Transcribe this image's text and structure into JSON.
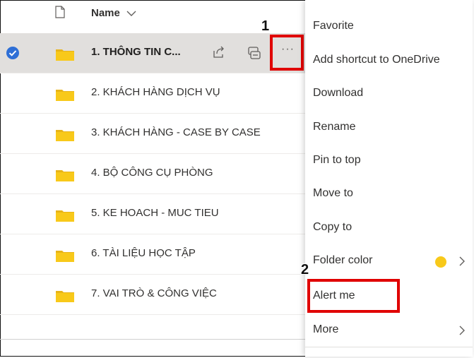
{
  "list": {
    "header": {
      "name_label": "Name"
    },
    "rows": [
      {
        "label": "1. THÔNG TIN C...",
        "selected": true
      },
      {
        "label": "2. KHÁCH HÀNG DỊCH VỤ"
      },
      {
        "label": "3. KHÁCH HÀNG - CASE BY CASE"
      },
      {
        "label": "4. BỘ CÔNG CỤ PHÒNG"
      },
      {
        "label": "5. KE HOACH - MUC TIEU"
      },
      {
        "label": "6. TÀI LIỆU HỌC TẬP"
      },
      {
        "label": "7. VAI TRÒ & CÔNG VIỆC"
      }
    ],
    "more_label": "···"
  },
  "menu": {
    "items": [
      {
        "label": "Favorite"
      },
      {
        "label": "Add shortcut to OneDrive"
      },
      {
        "label": "Download"
      },
      {
        "label": "Rename"
      },
      {
        "label": "Pin to top"
      },
      {
        "label": "Move to"
      },
      {
        "label": "Copy to"
      },
      {
        "label": "Folder color"
      },
      {
        "label": "Alert me"
      },
      {
        "label": "More"
      }
    ]
  },
  "annotations": {
    "step1": "1",
    "step2": "2"
  },
  "colors": {
    "folder": "#f8c91a",
    "folder_back": "#e8b418",
    "check": "#2f6fd6",
    "highlight": "#e00000",
    "folder_color_swatch": "#f8c91a"
  },
  "icons": {
    "checked": "check-circle-icon",
    "folder": "folder-icon",
    "share": "share-icon",
    "link": "link-icon",
    "file": "file-icon",
    "chevron": "chevron-right-icon"
  }
}
